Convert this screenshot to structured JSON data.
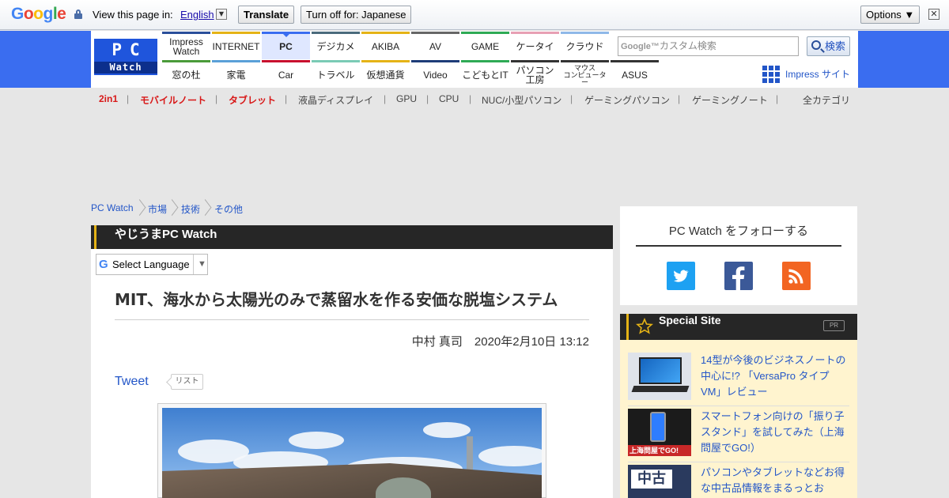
{
  "translate_bar": {
    "logo": "Google",
    "view_text": "View this page in:",
    "language": "English",
    "translate_btn": "Translate",
    "turn_off_btn": "Turn off for: Japanese",
    "options_btn": "Options ▼",
    "close": "✕"
  },
  "logo": {
    "line1": "PC",
    "line2": "Watch"
  },
  "nav_top": [
    {
      "label": "Impress\nWatch",
      "color": "#2a4f9a"
    },
    {
      "label": "INTERNET",
      "color": "#e5b316"
    },
    {
      "label": "PC",
      "color": "#3a6df0"
    },
    {
      "label": "デジカメ",
      "color": "#4a6b7c"
    },
    {
      "label": "AKIBA",
      "color": "#e5b316"
    },
    {
      "label": "AV",
      "color": "#666666"
    },
    {
      "label": "GAME",
      "color": "#2eaa55"
    },
    {
      "label": "ケータイ",
      "color": "#e7a0b4"
    },
    {
      "label": "クラウド",
      "color": "#8fb8e8"
    }
  ],
  "nav_bottom": [
    {
      "label": "窓の杜",
      "color": "#4a9b3a"
    },
    {
      "label": "家電",
      "color": "#5aa0d8"
    },
    {
      "label": "Car",
      "color": "#c8102e"
    },
    {
      "label": "トラベル",
      "color": "#7acbb5"
    },
    {
      "label": "仮想通貨",
      "color": "#e5b316"
    },
    {
      "label": "Video",
      "color": "#1e3c78"
    },
    {
      "label": "こどもとIT",
      "color": "#2eaa55"
    },
    {
      "label": "パソコン\n工房",
      "color": "#333333"
    },
    {
      "label": "マウス\nコンピューター",
      "color": "#333333"
    },
    {
      "label": "ASUS",
      "color": "#333333"
    }
  ],
  "search": {
    "brand": "Google™",
    "placeholder": "カスタム検索",
    "button": "検索"
  },
  "impress_link": "Impress サイト",
  "subnav": [
    "2in1",
    "モバイルノート",
    "タブレット",
    "液晶ディスプレイ",
    "GPU",
    "CPU",
    "NUC/小型パソコン",
    "ゲーミングパソコン",
    "ゲーミングノート"
  ],
  "all_categories": "全カテゴリ",
  "breadcrumb": [
    "PC Watch",
    "市場",
    "技術",
    "その他"
  ],
  "category": "やじうまPC Watch",
  "select_language": "Select Language",
  "article": {
    "title": "MIT、海水から太陽光のみで蒸留水を作る安価な脱塩システム",
    "byline": "中村 真司　2020年2月10日 13:12",
    "tweet": "Tweet",
    "list": "リスト"
  },
  "follow": {
    "title": "PC Watch をフォローする"
  },
  "special": {
    "title": "Special Site",
    "pr": "PR",
    "items": [
      {
        "text": "14型が今後のビジネスノートの中心に!? 「VersaPro タイプVM」レビュー"
      },
      {
        "text": "スマートフォン向けの「振り子スタンド」を試してみた（上海問屋でGO!）"
      },
      {
        "text": "パソコンやタブレットなどお得な中古品情報をまるっとお"
      }
    ]
  },
  "thumb_texts": {
    "t2": "上海問屋でGO!",
    "t3": "中古"
  }
}
